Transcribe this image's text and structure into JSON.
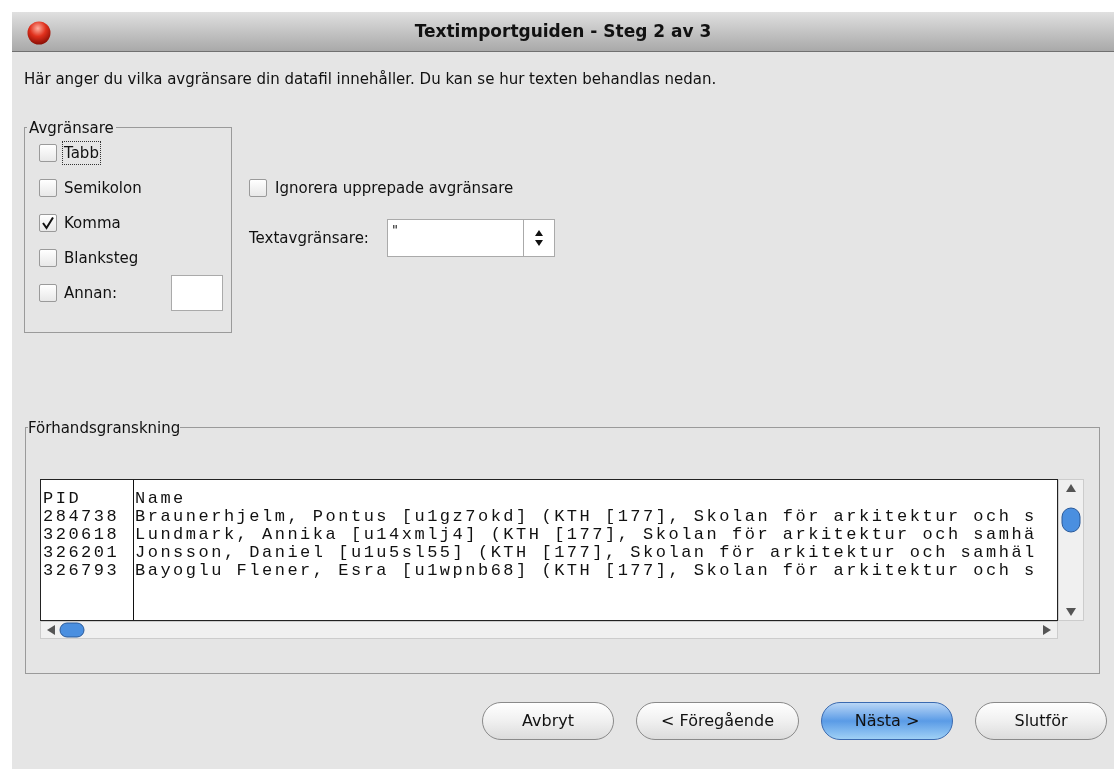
{
  "window": {
    "title": "Textimportguiden - Steg 2 av 3"
  },
  "instruction": "Här anger du vilka avgränsare din datafil innehåller. Du kan se hur texten behandlas nedan.",
  "separators": {
    "title": "Avgränsare",
    "options": [
      {
        "label": "Tabb",
        "checked": false,
        "focused": true
      },
      {
        "label": "Semikolon",
        "checked": false,
        "focused": false
      },
      {
        "label": "Komma",
        "checked": true,
        "focused": false
      },
      {
        "label": "Blanksteg",
        "checked": false,
        "focused": false
      },
      {
        "label": "Annan:",
        "checked": false,
        "focused": false,
        "kind": "with_field"
      }
    ]
  },
  "ignore_repeated": {
    "label": "Ignorera upprepade avgränsare",
    "checked": false
  },
  "text_delimiter": {
    "label": "Textavgränsare:",
    "value": "\""
  },
  "preview": {
    "title": "Förhandsgranskning",
    "columns": [
      "PID",
      "Name"
    ],
    "rows": [
      [
        "284738",
        "Braunerhjelm, Pontus [u1gz7okd] (KTH [177], Skolan för arkitektur och s"
      ],
      [
        "320618",
        "Lundmark, Annika [u14xmlj4] (KTH [177], Skolan för arkitektur och samhä"
      ],
      [
        "326201",
        "Jonsson, Daniel [u1u5sl55] (KTH [177], Skolan för arkitektur och samhäl"
      ],
      [
        "326793",
        "Bayoglu Flener, Esra [u1wpnb68] (KTH [177], Skolan för arkitektur och s"
      ]
    ]
  },
  "buttons": [
    {
      "label": "Avbryt",
      "default": false
    },
    {
      "label": "< Föregående",
      "default": false
    },
    {
      "label": "Nästa >",
      "default": true
    },
    {
      "label": "Slutför",
      "default": false
    }
  ]
}
